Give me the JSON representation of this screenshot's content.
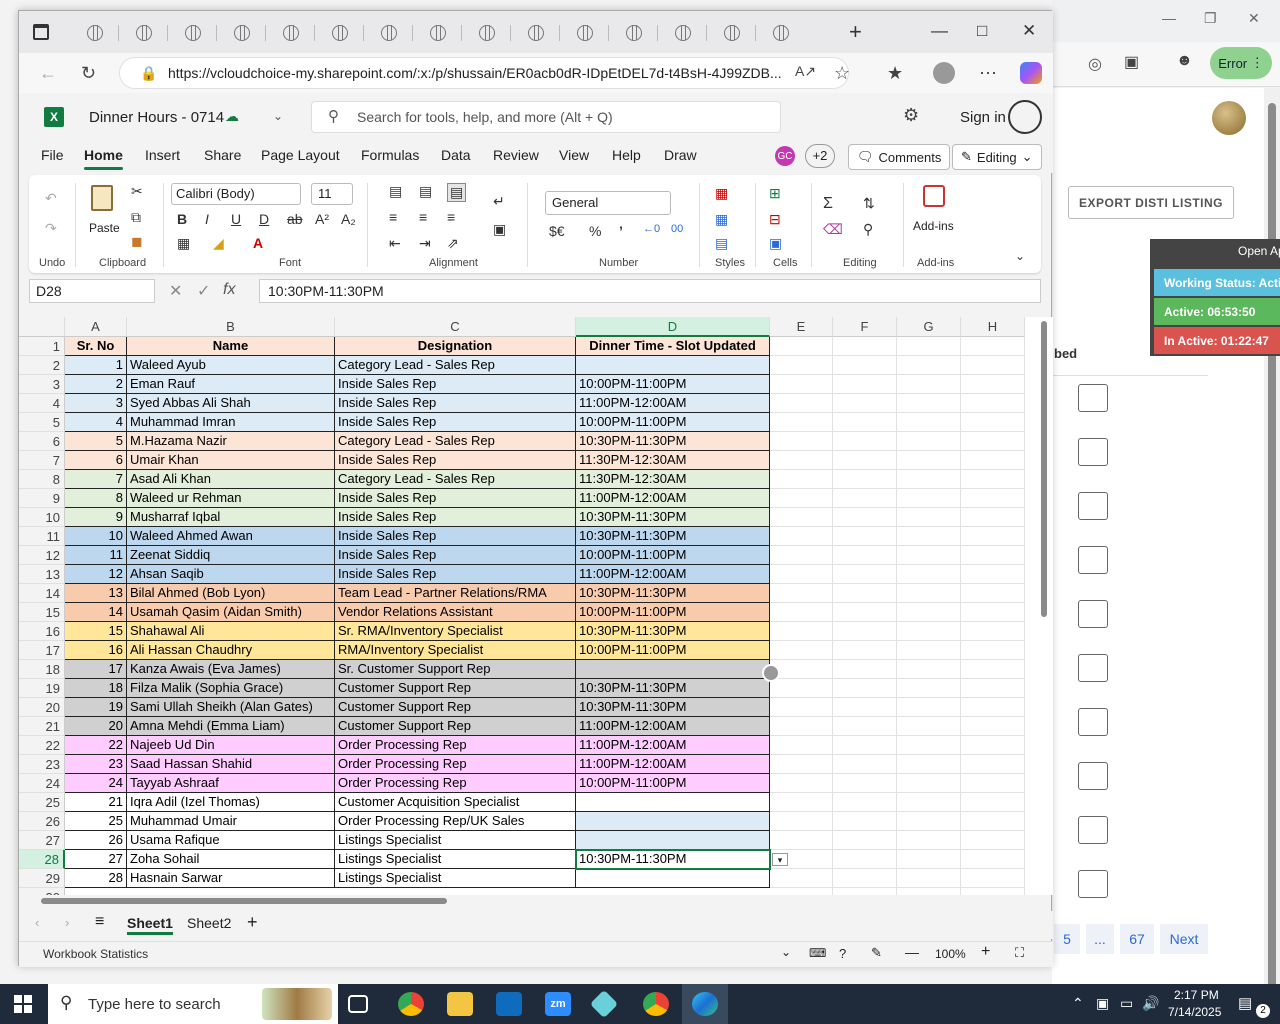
{
  "background": {
    "export_label": "EXPORT DISTI LISTING",
    "error_label": "Error",
    "table_header_fragment": "bed",
    "pager": [
      "5",
      "...",
      "67",
      "Next"
    ],
    "status_widget": {
      "title": "Open Ap",
      "working": "Working Status: Active",
      "active": "Active: 06:53:50",
      "inactive": "In Active: 01:22:47"
    }
  },
  "browser": {
    "url": "https://vcloudchoice-my.sharepoint.com/:x:/p/shussain/ER0acb0dR-IDpEtDEL7d-t4BsH-4J99ZDB..."
  },
  "excel": {
    "doc_title": "Dinner Hours - 0714",
    "search_placeholder": "Search for tools, help, and more (Alt + Q)",
    "sign_in": "Sign in",
    "menu": [
      "File",
      "Home",
      "Insert",
      "Share",
      "Page Layout",
      "Formulas",
      "Data",
      "Review",
      "View",
      "Help",
      "Draw"
    ],
    "coauthor_initials": "GC",
    "coauthor_more": "+2",
    "comments": "Comments",
    "editing": "Editing",
    "ribbon": {
      "undo": "Undo",
      "paste": "Paste",
      "clipboard": "Clipboard",
      "font_name": "Calibri (Body)",
      "font_size": "11",
      "font": "Font",
      "alignment": "Alignment",
      "number_format": "General",
      "number": "Number",
      "styles": "Styles",
      "cells": "Cells",
      "editing": "Editing",
      "addins": "Add-ins",
      "addins_group": "Add-ins"
    },
    "name_box": "D28",
    "formula": "10:30PM-11:30PM",
    "columns": [
      "A",
      "B",
      "C",
      "D",
      "E",
      "F",
      "G",
      "H"
    ],
    "headers": [
      "Sr. No",
      "Name",
      "Designation",
      "Dinner Time - Slot Updated"
    ],
    "rows": [
      {
        "n": "1",
        "name": "Waleed Ayub",
        "des": "Category Lead - Sales Rep",
        "time": "",
        "bg": "#ddebf7"
      },
      {
        "n": "2",
        "name": "Eman Rauf",
        "des": "Inside Sales Rep",
        "time": "10:00PM-11:00PM",
        "bg": "#ddebf7"
      },
      {
        "n": "3",
        "name": "Syed Abbas Ali Shah",
        "des": "Inside Sales Rep",
        "time": "11:00PM-12:00AM",
        "bg": "#ddebf7"
      },
      {
        "n": "4",
        "name": "Muhammad Imran",
        "des": "Inside Sales Rep",
        "time": "10:00PM-11:00PM",
        "bg": "#ddebf7"
      },
      {
        "n": "5",
        "name": "M.Hazama Nazir",
        "des": "Category Lead - Sales Rep",
        "time": "10:30PM-11:30PM",
        "bg": "#fce4d6"
      },
      {
        "n": "6",
        "name": "Umair Khan",
        "des": "Inside Sales Rep",
        "time": "11:30PM-12:30AM",
        "bg": "#fce4d6"
      },
      {
        "n": "7",
        "name": "Asad Ali Khan",
        "des": "Category Lead - Sales Rep",
        "time": "11:30PM-12:30AM",
        "bg": "#e2efda"
      },
      {
        "n": "8",
        "name": "Waleed ur Rehman",
        "des": "Inside Sales Rep",
        "time": "11:00PM-12:00AM",
        "bg": "#e2efda"
      },
      {
        "n": "9",
        "name": "Musharraf Iqbal",
        "des": "Inside Sales Rep",
        "time": "10:30PM-11:30PM",
        "bg": "#e2efda"
      },
      {
        "n": "10",
        "name": "Waleed Ahmed Awan",
        "des": "Inside Sales Rep",
        "time": "10:30PM-11:30PM",
        "bg": "#bdd7ee"
      },
      {
        "n": "11",
        "name": "Zeenat Siddiq",
        "des": "Inside Sales Rep",
        "time": "10:00PM-11:00PM",
        "bg": "#bdd7ee"
      },
      {
        "n": "12",
        "name": "Ahsan Saqib",
        "des": "Inside Sales Rep",
        "time": "11:00PM-12:00AM",
        "bg": "#bdd7ee"
      },
      {
        "n": "13",
        "name": "Bilal Ahmed (Bob Lyon)",
        "des": "Team Lead - Partner Relations/RMA",
        "time": "10:30PM-11:30PM",
        "bg": "#f8cbad"
      },
      {
        "n": "14",
        "name": "Usamah Qasim (Aidan Smith)",
        "des": "Vendor Relations Assistant",
        "time": "10:00PM-11:00PM",
        "bg": "#f8cbad"
      },
      {
        "n": "15",
        "name": "Shahawal Ali",
        "des": "Sr. RMA/Inventory Specialist",
        "time": "10:30PM-11:30PM",
        "bg": "#ffe699"
      },
      {
        "n": "16",
        "name": "Ali Hassan Chaudhry",
        "des": "RMA/Inventory Specialist",
        "time": "10:00PM-11:00PM",
        "bg": "#ffe699"
      },
      {
        "n": "17",
        "name": "Kanza Awais (Eva James)",
        "des": "Sr. Customer Support Rep",
        "time": "",
        "bg": "#d0d0d0"
      },
      {
        "n": "18",
        "name": "Filza Malik (Sophia Grace)",
        "des": "Customer Support Rep",
        "time": "10:30PM-11:30PM",
        "bg": "#d0d0d0"
      },
      {
        "n": "19",
        "name": "Sami Ullah Sheikh (Alan Gates)",
        "des": "Customer Support Rep",
        "time": "10:30PM-11:30PM",
        "bg": "#d0d0d0"
      },
      {
        "n": "20",
        "name": "Amna Mehdi (Emma Liam)",
        "des": "Customer Support Rep",
        "time": "11:00PM-12:00AM",
        "bg": "#d0d0d0"
      },
      {
        "n": "22",
        "name": "Najeeb Ud Din",
        "des": "Order Processing Rep",
        "time": "11:00PM-12:00AM",
        "bg": "#ffccff"
      },
      {
        "n": "23",
        "name": "Saad Hassan Shahid",
        "des": "Order Processing Rep",
        "time": "11:00PM-12:00AM",
        "bg": "#ffccff"
      },
      {
        "n": "24",
        "name": "Tayyab Ashraaf",
        "des": "Order Processing Rep",
        "time": "10:00PM-11:00PM",
        "bg": "#ffccff"
      },
      {
        "n": "21",
        "name": "Iqra Adil (Izel Thomas)",
        "des": "Customer Acquisition Specialist",
        "time": "",
        "bg": "#ffffff"
      },
      {
        "n": "25",
        "name": "Muhammad Umair",
        "des": "Order Processing Rep/UK Sales",
        "time": "",
        "bg": "#ffffff"
      },
      {
        "n": "26",
        "name": "Usama Rafique",
        "des": "Listings Specialist",
        "time": "",
        "bg": "#ffffff"
      },
      {
        "n": "27",
        "name": "Zoha Sohail",
        "des": "Listings Specialist",
        "time": "10:30PM-11:30PM",
        "bg": "#ffffff"
      },
      {
        "n": "28",
        "name": "Hasnain Sarwar",
        "des": "Listings Specialist",
        "time": "",
        "bg": "#ffffff"
      }
    ],
    "sheets": [
      "Sheet1",
      "Sheet2"
    ],
    "status_left": "Workbook Statistics",
    "zoom": "100%"
  },
  "taskbar": {
    "search_placeholder": "Type here to search",
    "time": "2:17 PM",
    "date": "7/14/2025",
    "notifications": "2"
  }
}
